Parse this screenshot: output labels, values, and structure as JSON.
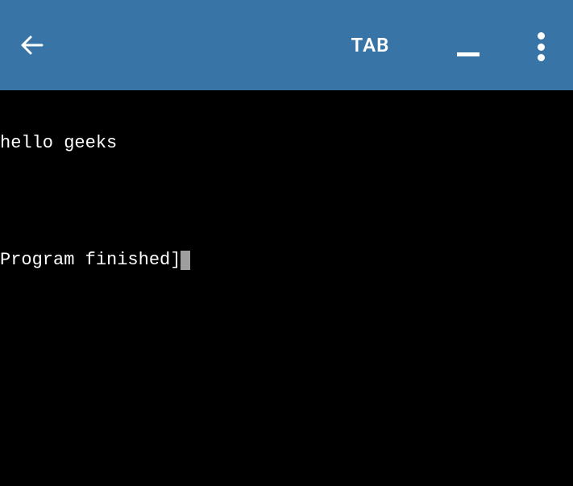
{
  "header": {
    "tab_label": "TAB"
  },
  "terminal": {
    "line1": "hello geeks",
    "line2": "Program finished]"
  }
}
